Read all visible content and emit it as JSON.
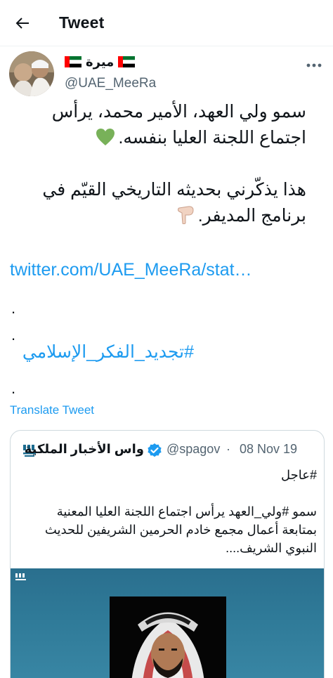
{
  "header": {
    "title": "Tweet"
  },
  "tweet": {
    "author_name": "ميرة",
    "handle": "@UAE_MeeRa",
    "body_line1": "سمو ولي العهد، الأمير محمد، يرأس",
    "body_line2": "اجتماع اللجنة العليا بنفسه.",
    "body_line3": "هذا يذكّرني بحديثه التاريخي القيّم في",
    "body_line4": "برنامج المديفر.",
    "link": "twitter.com/UAE_MeeRa/stat…",
    "dot": ".",
    "hashtag": "#تجديد_الفكر_الإسلامي",
    "translate_label": "Translate Tweet"
  },
  "quoted_tweet": {
    "author_name": "واس الأخبار الملكية",
    "handle": "@spagov",
    "separator": "·",
    "date": "08 Nov 19",
    "line1": "#عاجل",
    "line2": "سمو #ولي_العهد يرأس اجتماع اللجنة العليا المعنية",
    "line3": "بمتابعة أعمال مجمع خادم الحرمين الشريفين للحديث",
    "line4": "النبوي الشريف...."
  },
  "icons": {
    "back": "arrow-left-icon",
    "more": "more-horizontal-icon",
    "verified": "verified-badge-icon",
    "heart": "green-heart-emoji",
    "hand": "pointing-down-hand-emoji",
    "flag": "uae-flag-emoji"
  },
  "colors": {
    "link": "#1d9bf0",
    "secondary_text": "#536471",
    "border": "#cfd9de",
    "heart": "#78b159"
  }
}
